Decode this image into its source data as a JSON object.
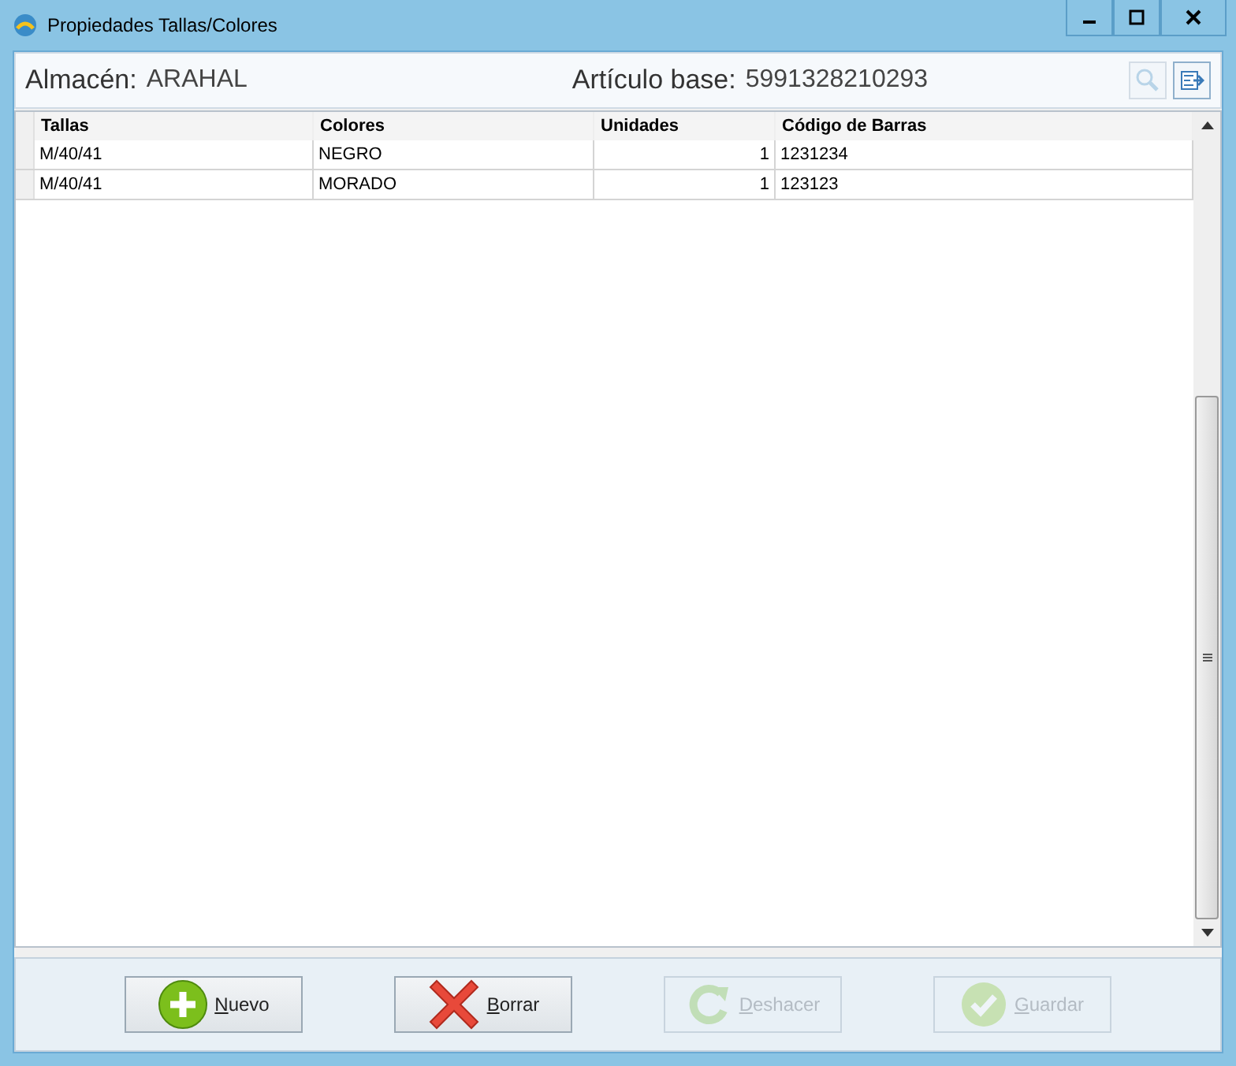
{
  "window": {
    "title": "Propiedades Tallas/Colores"
  },
  "header": {
    "store_label": "Almacén:",
    "store_value": "ARAHAL",
    "article_label": "Artículo base:",
    "article_value": "5991328210293"
  },
  "table": {
    "columns": [
      "Tallas",
      "Colores",
      "Unidades",
      "Código de Barras"
    ],
    "rows": [
      [
        "M/40/41",
        "NEGRO",
        "1",
        "1231234"
      ],
      [
        "M/40/41",
        "MORADO",
        "1",
        "123123"
      ]
    ]
  },
  "buttons": [
    {
      "kind": "add",
      "label": "Nuevo",
      "disabled": false
    },
    {
      "kind": "delete",
      "label": "Borrar",
      "disabled": false
    },
    {
      "kind": "undo",
      "label": "Deshacer",
      "disabled": true
    },
    {
      "kind": "save",
      "label": "Guardar",
      "disabled": true
    }
  ]
}
